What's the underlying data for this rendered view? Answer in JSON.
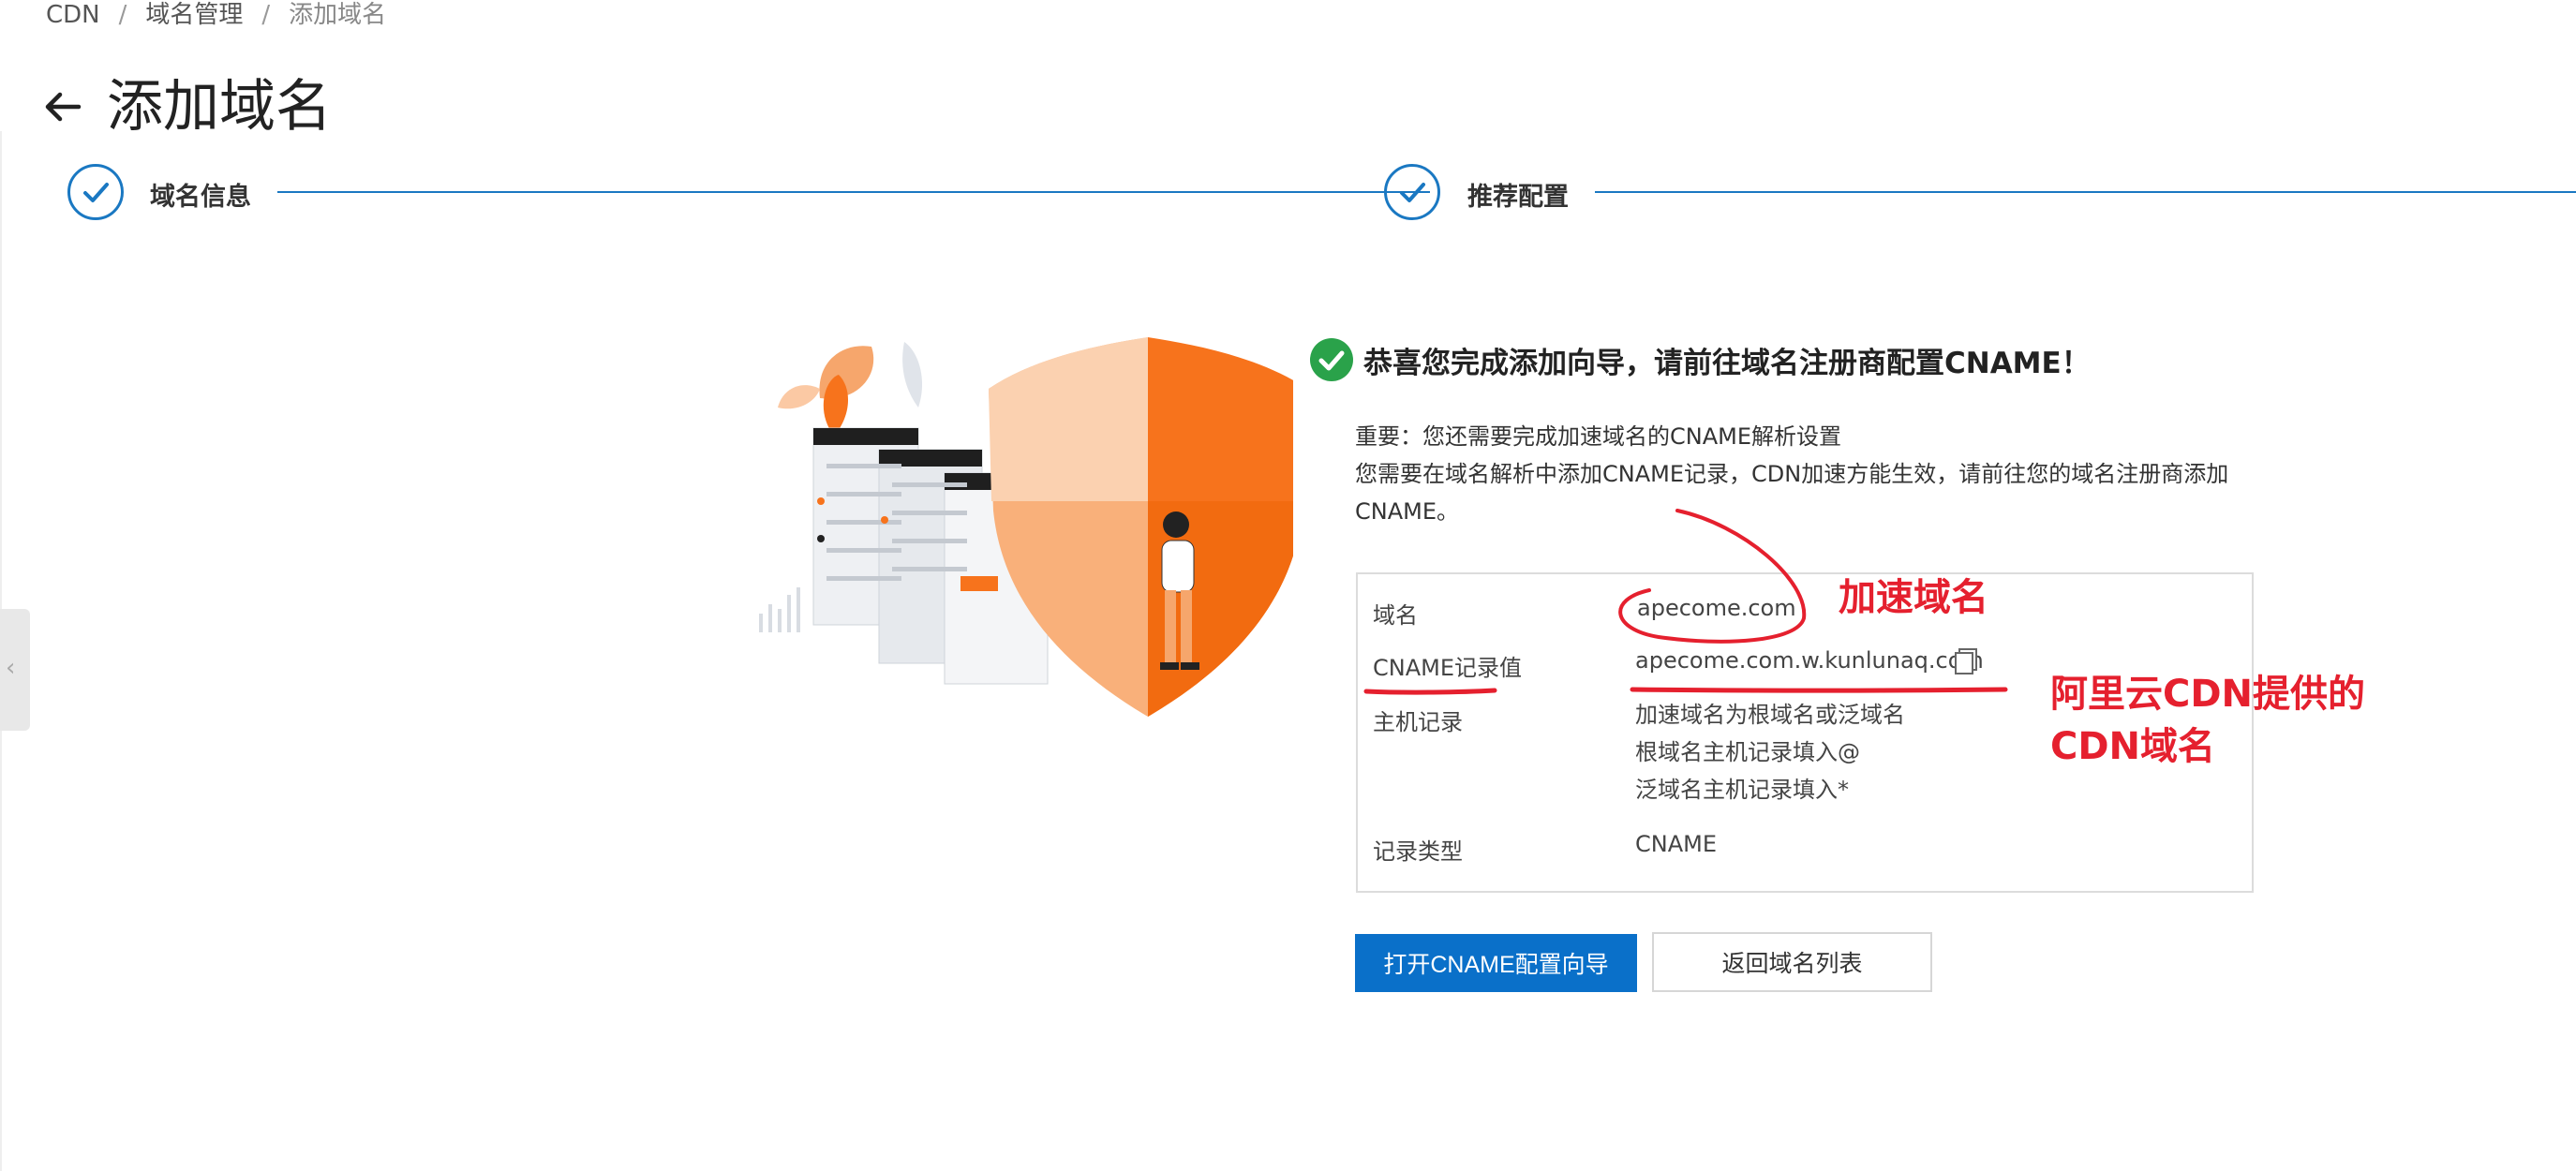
{
  "breadcrumb": [
    "CDN",
    "域名管理",
    "添加域名"
  ],
  "page_title": "添加域名",
  "steps": [
    {
      "label": "域名信息",
      "status": "done"
    },
    {
      "label": "推荐配置",
      "status": "done"
    }
  ],
  "success": {
    "title": "恭喜您完成添加向导，请前往域名注册商配置CNAME！",
    "desc_line1": "重要：您还需要完成加速域名的CNAME解析设置",
    "desc_line2": "您需要在域名解析中添加CNAME记录，CDN加速方能生效，请前往您的域名注册商添加",
    "desc_line3": "CNAME。"
  },
  "info": {
    "domain_label": "域名",
    "domain_value": "apecome.com",
    "cname_label": "CNAME记录值",
    "cname_value": "apecome.com.w.kunlunaq.com",
    "host_label": "主机记录",
    "host_line1": "加速域名为根域名或泛域名",
    "host_line2": "根域名主机记录填入@",
    "host_line3": "泛域名主机记录填入*",
    "type_label": "记录类型",
    "type_value": "CNAME"
  },
  "buttons": {
    "primary": "打开CNAME配置向导",
    "secondary": "返回域名列表"
  },
  "annotations": {
    "accel_domain": "加速域名",
    "cdn_domain_line1": "阿里云CDN提供的",
    "cdn_domain_line2": "CDN域名"
  },
  "colors": {
    "accent": "#0a70c9",
    "step": "#1a78c2",
    "success": "#2aa24a",
    "annotation": "#e5202e",
    "shield": "#f7731c"
  }
}
